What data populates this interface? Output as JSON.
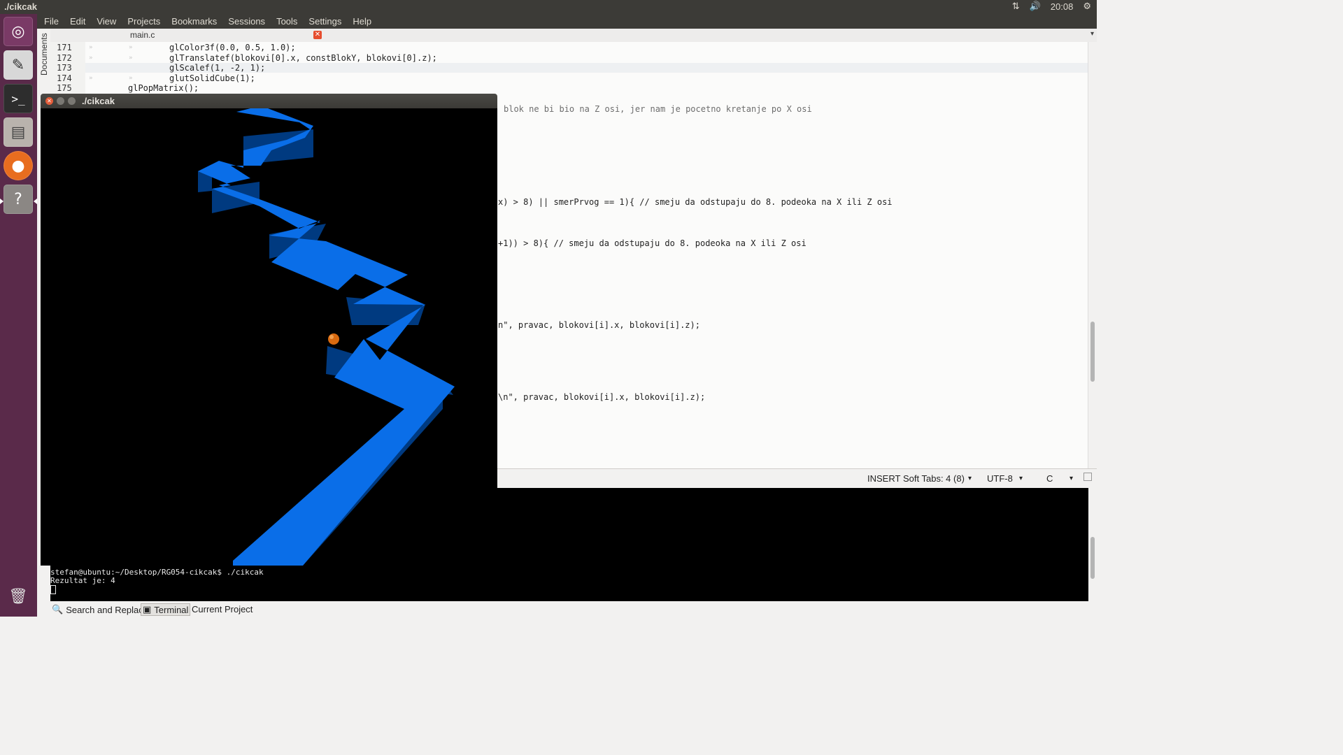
{
  "top_panel": {
    "window_title": "./cikcak",
    "time": "20:08",
    "icons": [
      "network-icon",
      "volume-icon",
      "gear-icon"
    ]
  },
  "launcher": {
    "items": [
      "ubuntu-dash-icon",
      "text-editor-icon",
      "terminal-icon",
      "files-icon",
      "firefox-icon",
      "help-icon",
      "trash-icon"
    ]
  },
  "menu": [
    "File",
    "Edit",
    "View",
    "Projects",
    "Bookmarks",
    "Sessions",
    "Tools",
    "Settings",
    "Help"
  ],
  "sidebar": {
    "documents_label": "Documents"
  },
  "editor": {
    "tab_label": "main.c",
    "lines": [
      {
        "n": "171",
        "code": "glColor3f(0.0, 0.5, 1.0);"
      },
      {
        "n": "172",
        "code": "glTranslatef(blokovi[0].x, constBlokY, blokovi[0].z);"
      },
      {
        "n": "173",
        "code": "glScalef(1, -2, 1);"
      },
      {
        "n": "174",
        "code": "glutSolidCube(1);"
      },
      {
        "n": "175",
        "code": "glPopMatrix();"
      }
    ],
    "visible_fragments": [
      "blok ne bi bio na Z osi, jer nam je pocetno kretanje po X osi",
      "x) > 8) || smerPrvog == 1){ // smeju da odstupaju do 8. podeoka na X ili Z osi",
      "+1)) > 8){ // smeju da odstupaju do 8. podeoka na X ili Z osi",
      "n\", pravac, blokovi[i].x, blokovi[i].z);",
      "\\n\", pravac, blokovi[i].x, blokovi[i].z);"
    ]
  },
  "statusbar": {
    "mode": "INSERT",
    "tabs": "Soft Tabs: 4 (8)",
    "encoding": "UTF-8",
    "language": "C"
  },
  "terminal": {
    "prompt": "stefan@ubuntu:~/Desktop/RG054-cikcak$ ./cikcak",
    "output": "Rezultat je: 4"
  },
  "bottom_tabs": [
    "Search and Replace",
    "Terminal",
    "Current Project"
  ],
  "gl_window": {
    "title": "./cikcak"
  },
  "colors": {
    "path_top": "#0a6ee8",
    "path_side": "#003a80",
    "ball": "#d86a10",
    "launcher_bg": "#5a2a4a",
    "panel_bg": "#3c3b37"
  }
}
